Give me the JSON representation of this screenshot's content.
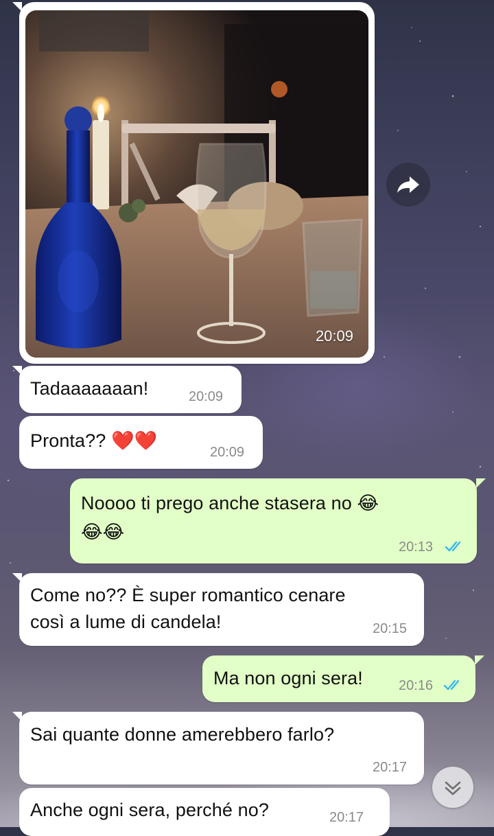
{
  "chat": {
    "photo_message": {
      "time": "20:09"
    },
    "messages": [
      {
        "direction": "in",
        "text": "Tadaaaaaaan!",
        "time": "20:09"
      },
      {
        "direction": "in",
        "text": "Pronta?? ❤️❤️",
        "time": "20:09"
      },
      {
        "direction": "out",
        "text_line1": "Noooo ti prego anche stasera no 😂",
        "text_line2": "😂😂",
        "time": "20:13",
        "status": "read"
      },
      {
        "direction": "in",
        "text_line1": "Come no?? È super romantico cenare",
        "text_line2": "così a lume di candela!",
        "time": "20:15"
      },
      {
        "direction": "out",
        "text": "Ma non ogni sera!",
        "time": "20:16",
        "status": "read"
      },
      {
        "direction": "in",
        "text": "Sai quante donne amerebbero farlo?",
        "time": "20:17"
      },
      {
        "direction": "in",
        "text": "Anche ogni sera, perché no?",
        "time": "20:17"
      }
    ]
  },
  "icons": {
    "forward": "forward-arrow-icon",
    "scroll_down": "chevron-down-icon",
    "read_ticks": "double-check-icon"
  },
  "colors": {
    "incoming_bubble": "#ffffff",
    "outgoing_bubble": "#e2ffc7",
    "read_ticks": "#34b7f1",
    "timestamp": "#8a8a8a"
  }
}
